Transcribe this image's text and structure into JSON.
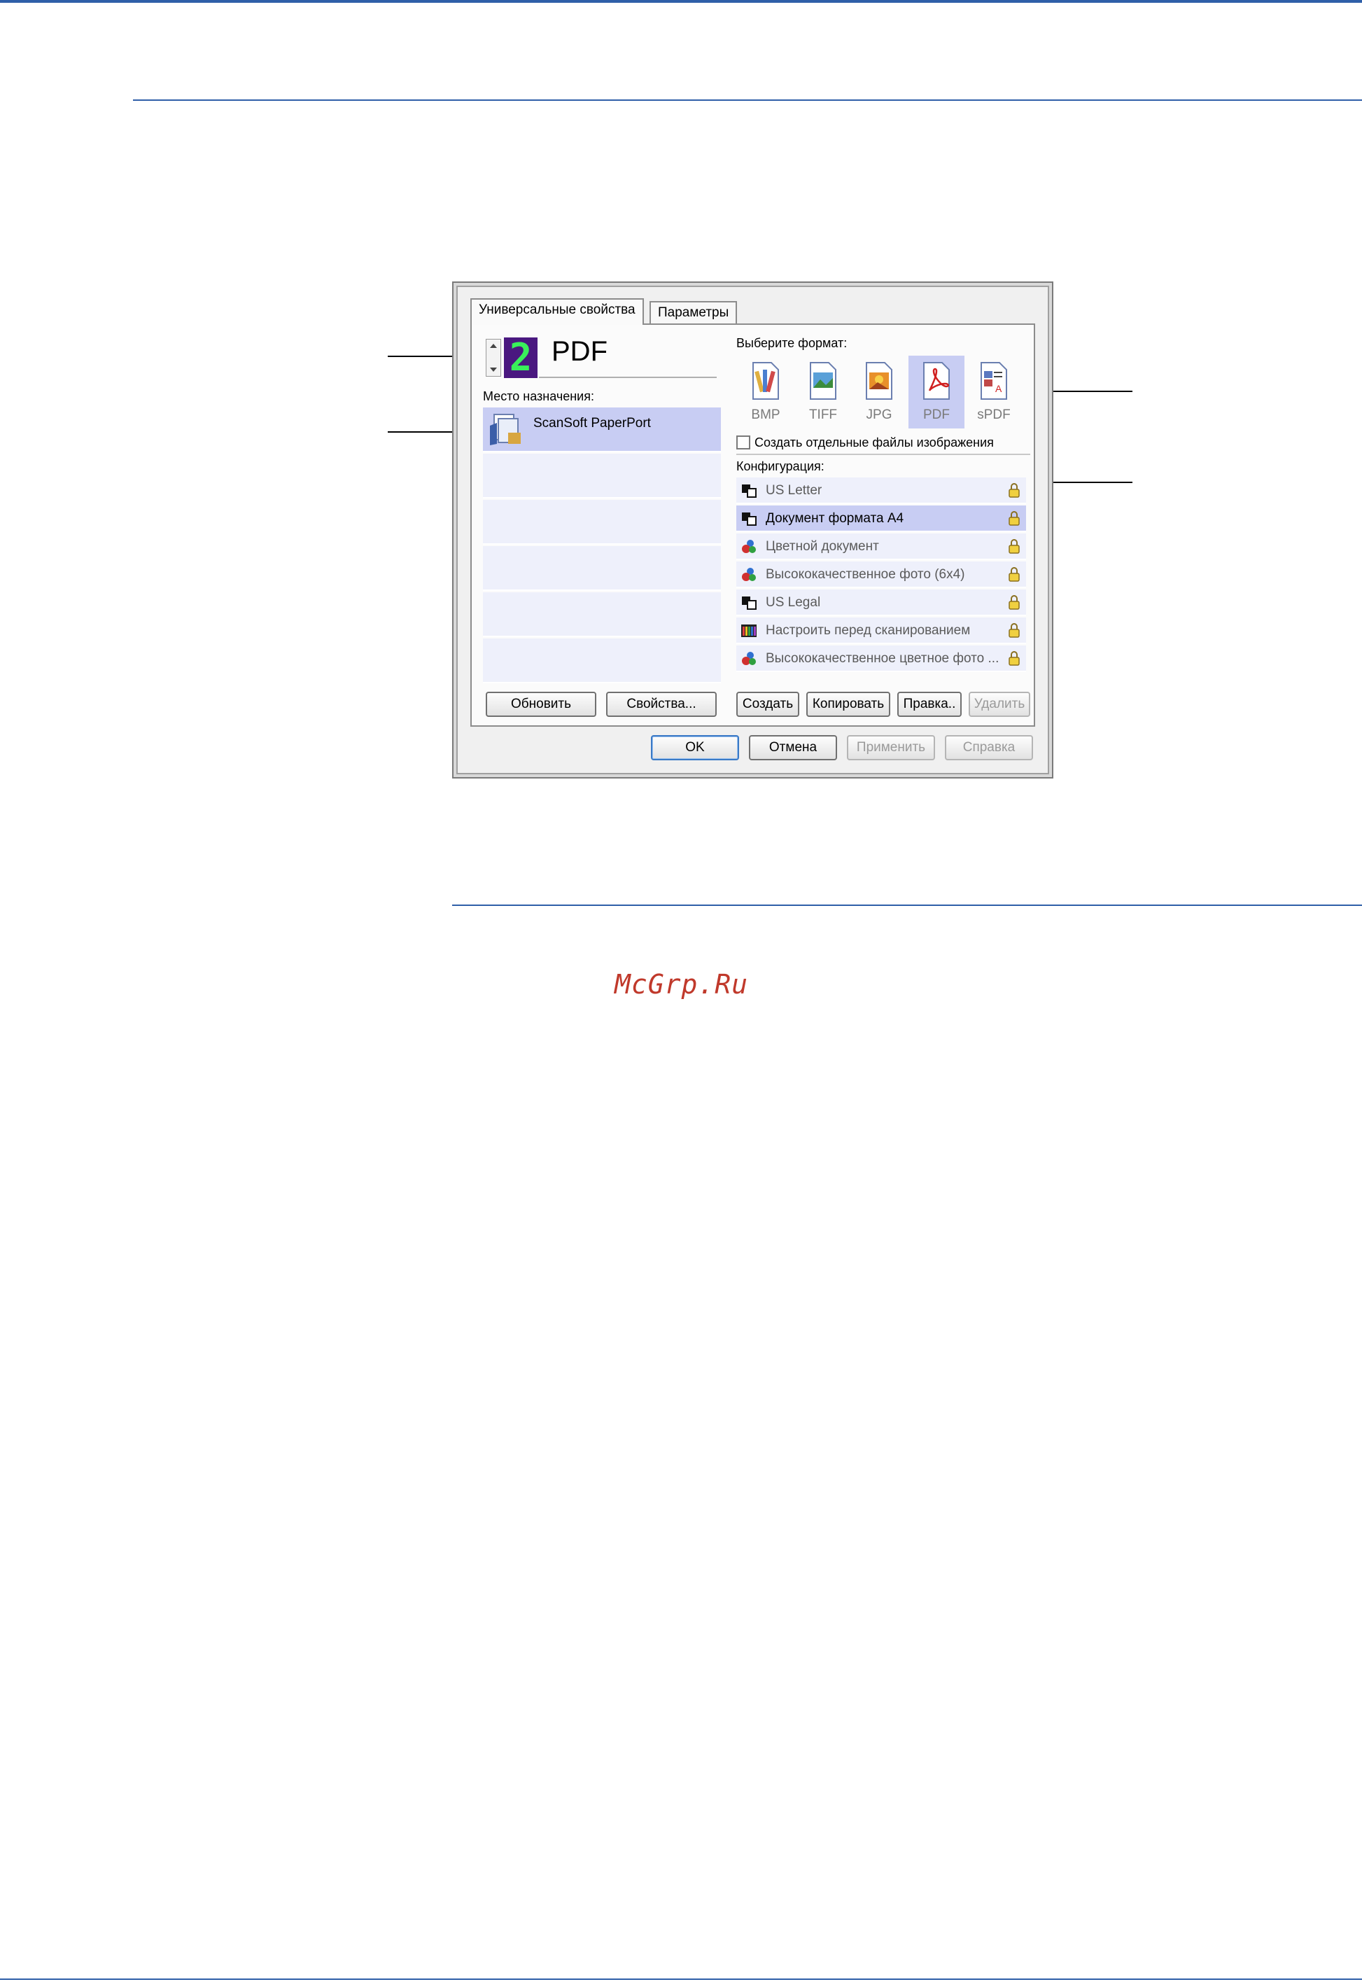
{
  "dialog": {
    "tabs": [
      {
        "label": "Универсальные свойства",
        "active": true
      },
      {
        "label": "Параметры",
        "active": false
      }
    ],
    "profile": {
      "number": "2",
      "name": "PDF"
    },
    "destination": {
      "label": "Место назначения:",
      "items": [
        {
          "name": "ScanSoft PaperPort",
          "icon": "paperport-icon",
          "selected": true
        }
      ],
      "buttons": {
        "refresh": "Обновить",
        "properties": "Свойства..."
      }
    },
    "format": {
      "label": "Выберите формат:",
      "items": [
        {
          "name": "BMP",
          "icon": "bmp-file-icon"
        },
        {
          "name": "TIFF",
          "icon": "tiff-file-icon"
        },
        {
          "name": "JPG",
          "icon": "jpg-file-icon"
        },
        {
          "name": "PDF",
          "icon": "pdf-file-icon",
          "selected": true
        },
        {
          "name": "sPDF",
          "icon": "spdf-file-icon"
        }
      ],
      "separate_files_checkbox": {
        "label": "Создать отдельные файлы изображения",
        "checked": false
      }
    },
    "configuration": {
      "label": "Конфигурация:",
      "items": [
        {
          "name": "US Letter",
          "icon": "bw-config-icon",
          "locked": true
        },
        {
          "name": "Документ формата A4",
          "icon": "bw-config-icon",
          "locked": true,
          "selected": true
        },
        {
          "name": "Цветной документ",
          "icon": "color-config-icon",
          "locked": true
        },
        {
          "name": "Высококачественное фото (6x4)",
          "icon": "color-config-icon",
          "locked": true
        },
        {
          "name": "US Legal",
          "icon": "bw-config-icon",
          "locked": true
        },
        {
          "name": "Настроить перед сканированием",
          "icon": "configure-config-icon",
          "locked": true
        },
        {
          "name": "Высококачественное цветное фото ...",
          "icon": "color-config-icon",
          "locked": true
        }
      ],
      "buttons": {
        "create": "Создать",
        "copy": "Копировать",
        "edit": "Правка..",
        "delete": "Удалить"
      }
    },
    "footer_buttons": {
      "ok": "OK",
      "cancel": "Отмена",
      "apply": "Применить",
      "help": "Справка"
    }
  },
  "watermark": "McGrp.Ru",
  "colors": {
    "rule": "#2f5fa8",
    "selection": "#c8cdf3",
    "list_bg": "#eef0fb",
    "watermark": "#c0392b"
  }
}
